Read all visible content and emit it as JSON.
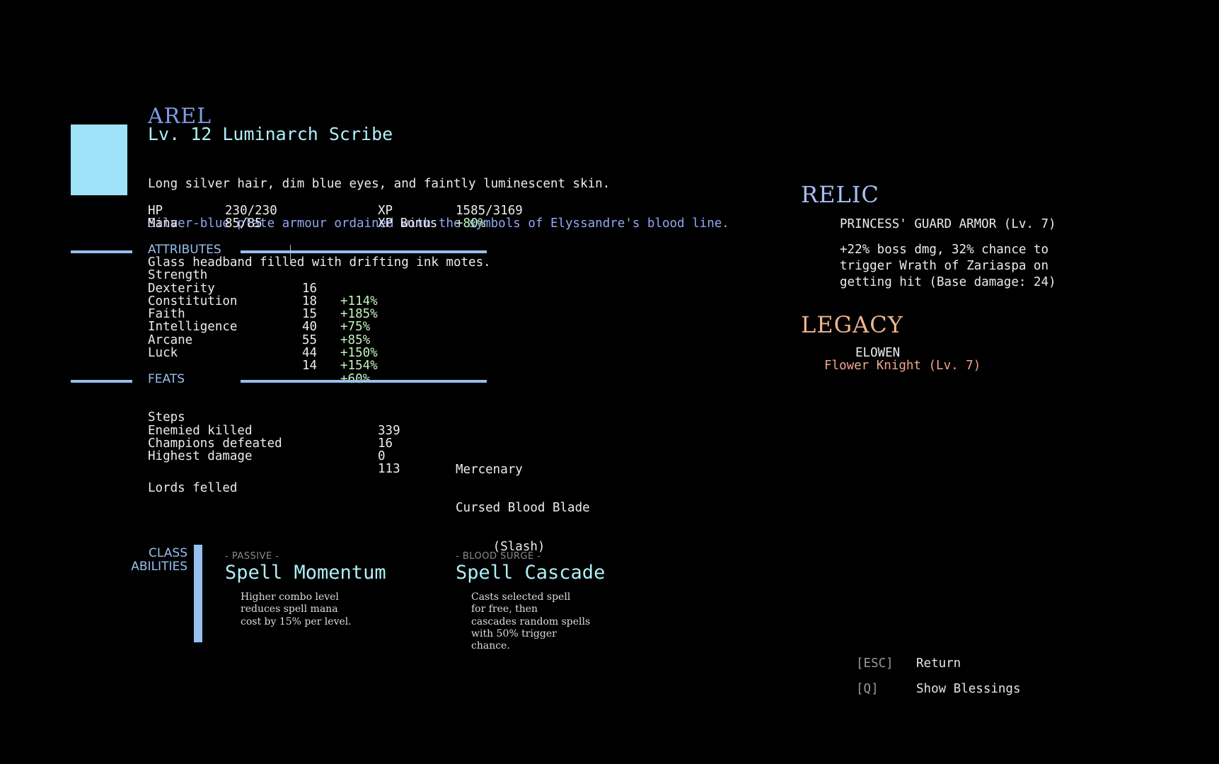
{
  "character": {
    "name": "AREL",
    "subtitle": "Lv. 12 Luminarch Scribe",
    "description": [
      "Long silver hair, dim blue eyes, and faintly luminescent skin.",
      "Silver-blue plate armour ordained with the symbols of Elyssandre's blood line.",
      "Glass headband filled with drifting ink motes."
    ],
    "portrait_color": "#9fe3f8"
  },
  "stats": {
    "hp_label": "HP",
    "hp_value": "230/230",
    "mana_label": "Mana",
    "mana_value": "85/85",
    "xp_label": "XP",
    "xp_value": "1585/3169",
    "xp_bonus_label": "XP Bonus",
    "xp_bonus_value": "+80%"
  },
  "attributes": {
    "header": "ATTRIBUTES",
    "rows": [
      {
        "name": "Strength",
        "value": "16",
        "bonus": "+114%"
      },
      {
        "name": "Dexterity",
        "value": "18",
        "bonus": "+185%"
      },
      {
        "name": "Constitution",
        "value": "15",
        "bonus": "+75%"
      },
      {
        "name": "Faith",
        "value": "40",
        "bonus": "+85%"
      },
      {
        "name": "Intelligence",
        "value": "55",
        "bonus": "+150%"
      },
      {
        "name": "Arcane",
        "value": "44",
        "bonus": "+154%"
      },
      {
        "name": "Luck",
        "value": "14",
        "bonus": "+60%"
      }
    ]
  },
  "feats": {
    "header": "FEATS",
    "rows": [
      {
        "name": "Steps",
        "value": "339"
      },
      {
        "name": "Enemied killed",
        "value": "16"
      },
      {
        "name": "Champions defeated",
        "value": "0"
      },
      {
        "name": "Highest damage",
        "value": "113"
      }
    ],
    "highest_damage_detail": [
      "Mercenary",
      "Cursed Blood Blade",
      "     (Slash)"
    ],
    "lords_label": "Lords felled"
  },
  "abilities": {
    "label_line1": "CLASS",
    "label_line2": "ABILITIES",
    "items": [
      {
        "tag": "- PASSIVE -",
        "title": "Spell Momentum",
        "desc": "Higher combo level\nreduces spell mana\ncost by 15% per level."
      },
      {
        "tag": "- BLOOD SURGE -",
        "title": "Spell Cascade",
        "desc": "Casts selected spell\nfor free, then\ncascades random spells\nwith 50% trigger\nchance."
      }
    ]
  },
  "relic": {
    "header": "RELIC",
    "name": "PRINCESS' GUARD ARMOR (Lv. 7)",
    "desc": "+22% boss dmg, 32% chance to\ntrigger Wrath of Zariaspa on\ngetting hit (Base damage: 24)"
  },
  "legacy": {
    "header": "LEGACY",
    "name": "ELOWEN",
    "subtitle": "Flower Knight (Lv. 7)"
  },
  "controls": [
    {
      "key": "[ESC]",
      "label": "Return"
    },
    {
      "key": "[Q]",
      "label": "Show Blessings"
    }
  ],
  "colors": {
    "background": "#000000",
    "accent_blue": "#95c0f0",
    "name_blue": "#7d9ce6",
    "cyan": "#aef0f8",
    "green_bonus": "#c2f5bf",
    "legacy_orange": "#f0b48e",
    "legacy_pink": "#f4a494"
  }
}
